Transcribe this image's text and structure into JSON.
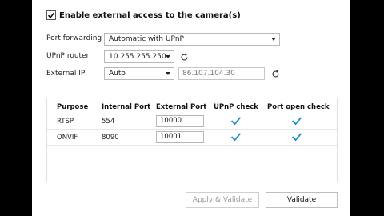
{
  "external_access": {
    "label": "Enable external access to the camera(s)",
    "checked": true
  },
  "port_forwarding": {
    "label": "Port forwarding",
    "value": "Automatic with UPnP"
  },
  "upnp_router": {
    "label": "UPnP router",
    "value": "10.255.255.250"
  },
  "external_ip": {
    "label": "External IP",
    "mode": "Auto",
    "value": "86.107.104.30"
  },
  "table": {
    "headers": [
      "Purpose",
      "Internal Port",
      "External Port",
      "UPnP check",
      "Port open check"
    ],
    "rows": [
      {
        "purpose": "RTSP",
        "internal": "554",
        "external": "10000",
        "upnp_ok": true,
        "open_ok": true
      },
      {
        "purpose": "ONVIF",
        "internal": "8090",
        "external": "10001",
        "upnp_ok": true,
        "open_ok": true
      }
    ]
  },
  "buttons": {
    "apply_validate": "Apply & Validate",
    "validate": "Validate"
  },
  "colors": {
    "accent": "#1c8fc9"
  }
}
